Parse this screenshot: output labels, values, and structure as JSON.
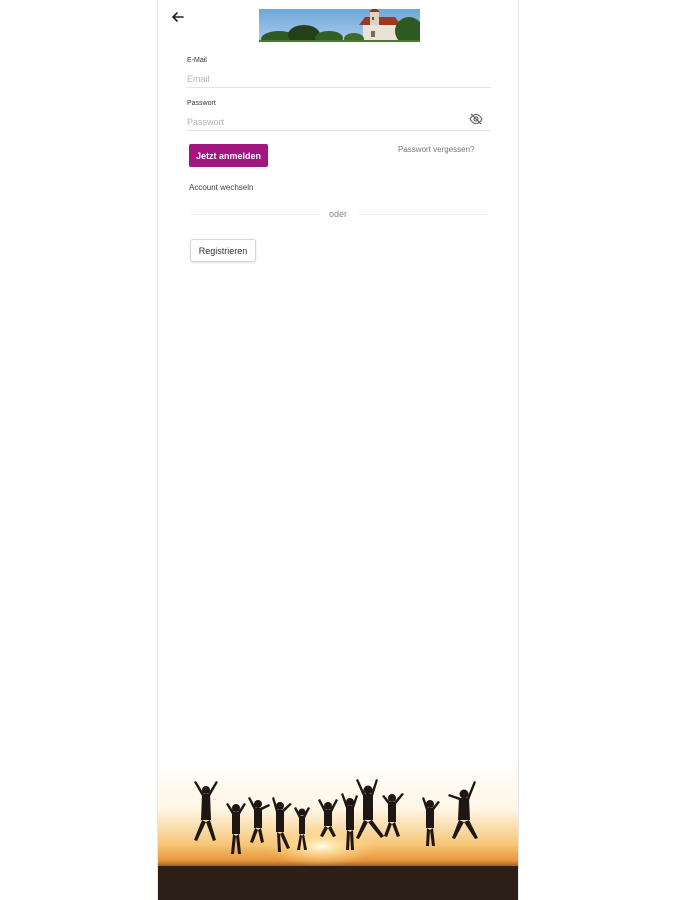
{
  "header": {
    "back_icon": "arrow-left-icon",
    "image_description": "church-landscape"
  },
  "form": {
    "email": {
      "label": "E-Mail",
      "placeholder": "Email",
      "value": ""
    },
    "password": {
      "label": "Passwort",
      "placeholder": "Passwort",
      "value": "",
      "toggle_icon": "eye-off-icon"
    },
    "login_label": "Jetzt anmelden",
    "forgot_label": "Passwort vergessen?",
    "switch_account_label": "Account wechseln",
    "divider_label": "oder",
    "register_label": "Registrieren"
  },
  "footer": {
    "image_description": "people-jumping-sunset"
  },
  "colors": {
    "accent": "#a3157f",
    "background": "#ffffff"
  }
}
